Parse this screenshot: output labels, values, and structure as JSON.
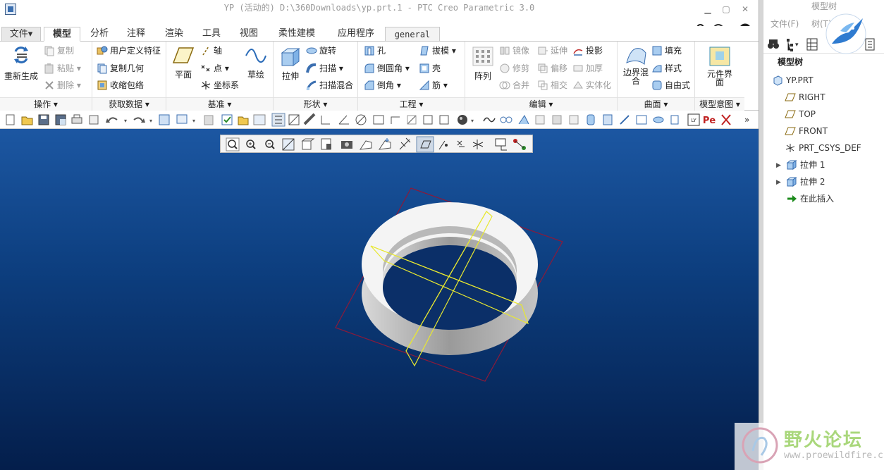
{
  "window": {
    "title": "YP (活动的) D:\\360Downloads\\yp.prt.1 - PTC Creo Parametric 3.0",
    "minimize": "▭",
    "maximize": "▭",
    "close": "✕"
  },
  "tabs": [
    {
      "label": "文件▾"
    },
    {
      "label": "模型"
    },
    {
      "label": "分析"
    },
    {
      "label": "注释"
    },
    {
      "label": "渲染"
    },
    {
      "label": "工具"
    },
    {
      "label": "视图"
    },
    {
      "label": "柔性建模"
    },
    {
      "label": "应用程序"
    },
    {
      "label": "general"
    }
  ],
  "ribbon": {
    "operations": {
      "label": "操作 ▾",
      "regen": "重新生成",
      "copy": "复制",
      "paste": "粘贴 ▾",
      "delete": "删除 ▾"
    },
    "get_data": {
      "label": "获取数据 ▾",
      "udf": "用户定义特征",
      "copy_geom": "复制几何",
      "shrinkwrap": "收缩包络"
    },
    "datum": {
      "label": "基准 ▾",
      "plane": "平面",
      "axis": "轴",
      "point": "点 ▾",
      "csys": "坐标系",
      "sketch": "草绘"
    },
    "shapes": {
      "label": "形状 ▾",
      "extrude": "拉伸",
      "revolve": "旋转",
      "sweep": "扫描 ▾",
      "swept_blend": "扫描混合"
    },
    "engineering": {
      "label": "工程 ▾",
      "hole": "孔",
      "round": "倒圆角 ▾",
      "chamfer": "倒角 ▾",
      "draft": "拔模 ▾",
      "shell": "壳",
      "rib": "筋 ▾"
    },
    "editing": {
      "label": "编辑 ▾",
      "pattern": "阵列",
      "mirror": "镜像",
      "trim": "修剪",
      "merge": "合并",
      "extend": "延伸",
      "offset": "偏移",
      "intersect": "相交",
      "project": "投影",
      "thicken": "加厚",
      "solidify": "实体化"
    },
    "surfaces": {
      "label": "曲面 ▾",
      "boundary_blend": "边界混合",
      "fill": "填充",
      "style": "样式",
      "freestyle": "自由式"
    },
    "model_intent": {
      "label": "模型意图 ▾",
      "component_interface": "元件界面"
    }
  },
  "model_tree": {
    "title": "模型树",
    "menu_file": "文件(F)",
    "menu_tree": "树(T)",
    "header": "模型树",
    "items": [
      {
        "label": "YP.PRT"
      },
      {
        "label": "RIGHT"
      },
      {
        "label": "TOP"
      },
      {
        "label": "FRONT"
      },
      {
        "label": "PRT_CSYS_DEF"
      },
      {
        "label": "拉伸 1"
      },
      {
        "label": "拉伸 2"
      },
      {
        "label": "在此插入"
      }
    ]
  },
  "watermark": {
    "text": "野火论坛",
    "url": "www.proewildfire.cn"
  },
  "colors": {
    "viewport_top": "#1c57a2",
    "viewport_bottom": "#041e4b",
    "datum_plane": "#e8e830",
    "csys_frame": "#8b1a3a"
  }
}
